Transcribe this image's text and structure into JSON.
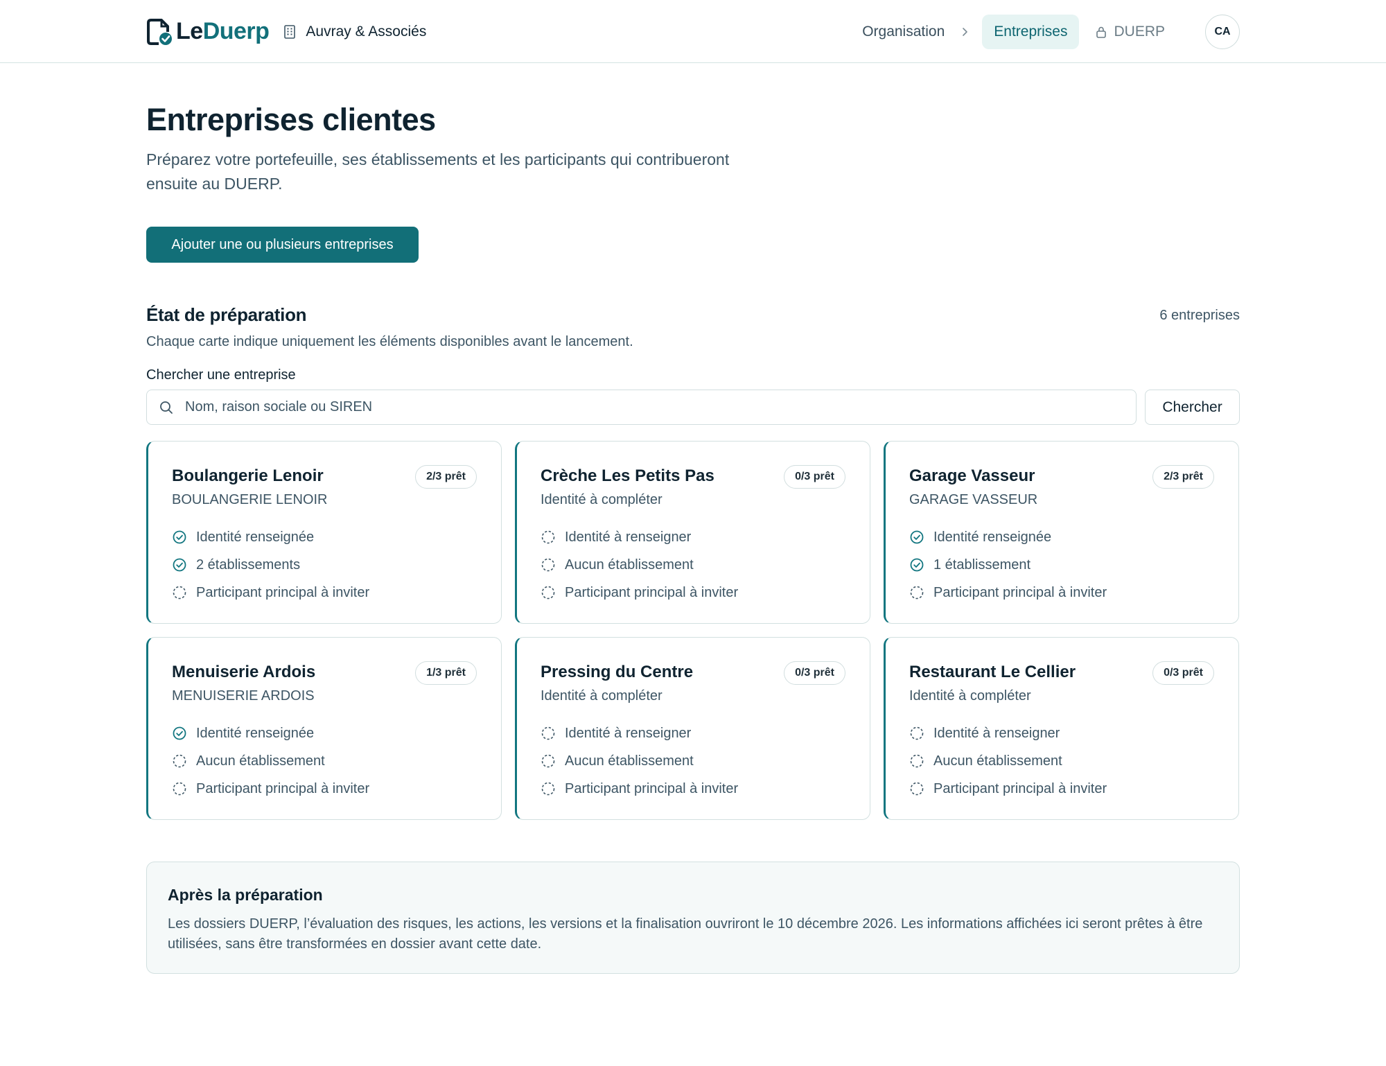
{
  "header": {
    "brand_part1": "Le",
    "brand_part2": "Duerp",
    "org_name": "Auvray & Associés",
    "nav": {
      "organisation": "Organisation",
      "entreprises": "Entreprises",
      "duerp": "DUERP"
    },
    "avatar_initials": "CA"
  },
  "page": {
    "title": "Entreprises clientes",
    "subtitle": "Préparez votre portefeuille, ses établissements et les participants qui contribueront ensuite au DUERP.",
    "add_button": "Ajouter une ou plusieurs entreprises"
  },
  "preparation": {
    "title": "État de préparation",
    "count": "6 entreprises",
    "description": "Chaque carte indique uniquement les éléments disponibles avant le lancement.",
    "search_label": "Chercher une entreprise",
    "search_placeholder": "Nom, raison sociale ou SIREN",
    "search_button": "Chercher"
  },
  "companies": [
    {
      "name": "Boulangerie Lenoir",
      "badge": "2/3 prêt",
      "subtitle": "BOULANGERIE LENOIR",
      "items": [
        {
          "label": "Identité renseignée",
          "done": true
        },
        {
          "label": "2 établissements",
          "done": true
        },
        {
          "label": "Participant principal à inviter",
          "done": false
        }
      ]
    },
    {
      "name": "Crèche Les Petits Pas",
      "badge": "0/3 prêt",
      "subtitle": "Identité à compléter",
      "items": [
        {
          "label": "Identité à renseigner",
          "done": false
        },
        {
          "label": "Aucun établissement",
          "done": false
        },
        {
          "label": "Participant principal à inviter",
          "done": false
        }
      ]
    },
    {
      "name": "Garage Vasseur",
      "badge": "2/3 prêt",
      "subtitle": "GARAGE VASSEUR",
      "items": [
        {
          "label": "Identité renseignée",
          "done": true
        },
        {
          "label": "1 établissement",
          "done": true
        },
        {
          "label": "Participant principal à inviter",
          "done": false
        }
      ]
    },
    {
      "name": "Menuiserie Ardois",
      "badge": "1/3 prêt",
      "subtitle": "MENUISERIE ARDOIS",
      "items": [
        {
          "label": "Identité renseignée",
          "done": true
        },
        {
          "label": "Aucun établissement",
          "done": false
        },
        {
          "label": "Participant principal à inviter",
          "done": false
        }
      ]
    },
    {
      "name": "Pressing du Centre",
      "badge": "0/3 prêt",
      "subtitle": "Identité à compléter",
      "items": [
        {
          "label": "Identité à renseigner",
          "done": false
        },
        {
          "label": "Aucun établissement",
          "done": false
        },
        {
          "label": "Participant principal à inviter",
          "done": false
        }
      ]
    },
    {
      "name": "Restaurant Le Cellier",
      "badge": "0/3 prêt",
      "subtitle": "Identité à compléter",
      "items": [
        {
          "label": "Identité à renseigner",
          "done": false
        },
        {
          "label": "Aucun établissement",
          "done": false
        },
        {
          "label": "Participant principal à inviter",
          "done": false
        }
      ]
    }
  ],
  "after": {
    "title": "Après la préparation",
    "text": "Les dossiers DUERP, l’évaluation des risques, les actions, les versions et la finalisation ouvriront le 10 décembre 2026. Les informations affichées ici seront prêtes à être utilisées, sans être transformées en dossier avant cette date."
  },
  "colors": {
    "accent": "#126f78",
    "nav_active_bg": "#e6f4f3",
    "done_icon": "#127680",
    "pending_icon": "#3d5564"
  },
  "icons": {
    "brand": "document-check-icon",
    "org": "building-icon",
    "breadcrumb": "chevron-right-icon",
    "locked": "lock-icon",
    "search": "search-icon",
    "done": "check-circle-icon",
    "pending": "dashed-circle-icon"
  }
}
